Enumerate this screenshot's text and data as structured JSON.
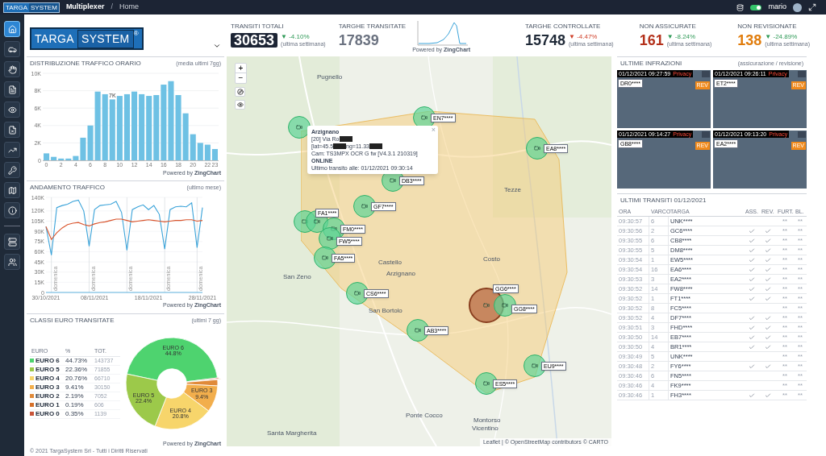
{
  "topbar": {
    "brand": [
      "TARGA",
      "SYSTEM"
    ],
    "app": "Multiplexer",
    "separator": "/",
    "page": "Home",
    "db_online": true,
    "user": "mario"
  },
  "sidebar": {
    "items": [
      {
        "selected": true
      },
      {
        "selected": false
      },
      {
        "selected": false
      },
      {
        "selected": false
      },
      {
        "selected": false
      },
      {
        "selected": false
      },
      {
        "selected": false
      },
      {
        "selected": false
      },
      {
        "selected": false
      },
      {
        "selected": false
      },
      {
        "selected": false
      },
      {
        "selected": false
      }
    ]
  },
  "header": {
    "logo": [
      "TARGA",
      "SYSTEM"
    ],
    "logo_mark": "®"
  },
  "kpis": [
    {
      "label": "TRANSITI TOTALI",
      "value": "30653",
      "kind": "boxed",
      "color": "#1c2434",
      "change": {
        "text": "▼ -4.10%",
        "color": "#2f9a57"
      },
      "period": "(ultima settimana)"
    },
    {
      "label": "TARGHE TRANSITATE",
      "value": "17839",
      "kind": "plain",
      "color": "#6b7280"
    },
    {
      "label": "TARGHE CONTROLLATE",
      "value": "15748",
      "kind": "plain",
      "color": "#1f2937",
      "change": {
        "text": "▼ -4.47%",
        "color": "#d0402a"
      },
      "period": "(ultima settimana)"
    },
    {
      "label": "NON ASSICURATE",
      "value": "161",
      "kind": "plain",
      "color": "#b4321c",
      "change": {
        "text": "▼ -8.24%",
        "color": "#2f9a57"
      },
      "period": "(ultima settimana)"
    },
    {
      "label": "NON REVISIONATE",
      "value": "138",
      "kind": "plain",
      "color": "#e07c0c",
      "change": {
        "text": "▼ -24.89%",
        "color": "#2f9a57"
      },
      "period": "(ultima settimana)"
    }
  ],
  "sparkline": {
    "credit": "Powered by **ZingChart**"
  },
  "hourly": {
    "title": "DISTRIBUZIONE TRAFFICO ORARIO",
    "note": "(media ultimi 7gg)",
    "credit": "Powered by **ZingChart**",
    "chart_data": {
      "type": "bar",
      "x": [
        0,
        1,
        2,
        3,
        4,
        5,
        6,
        7,
        8,
        9,
        10,
        11,
        12,
        13,
        14,
        15,
        16,
        17,
        18,
        19,
        20,
        21,
        22,
        23
      ],
      "series": [
        {
          "color": "#6ec1e4",
          "values": [
            800,
            400,
            200,
            200,
            500,
            2600,
            4000,
            7900,
            7600,
            7000,
            7400,
            7600,
            7900,
            7600,
            7400,
            7500,
            8700,
            9100,
            7500,
            5400,
            3000,
            2000,
            1800,
            1300
          ]
        }
      ],
      "xlim": [
        -0.5,
        23.5
      ],
      "ylim": [
        0,
        10000
      ],
      "grid": true,
      "xticks": [
        0,
        2,
        4,
        6,
        8,
        10,
        12,
        14,
        16,
        18,
        20,
        22,
        23
      ],
      "yticks": [
        {
          "value": 0,
          "label": "0"
        },
        {
          "value": 2000,
          "label": "2K"
        },
        {
          "value": 4000,
          "label": "4K"
        },
        {
          "value": 6000,
          "label": "6K"
        },
        {
          "value": 8000,
          "label": "8K"
        },
        {
          "value": 10000,
          "label": "10K"
        }
      ],
      "annotations": [
        {
          "x": 9,
          "y": 7000,
          "text": "7K"
        }
      ]
    }
  },
  "trend": {
    "title": "ANDAMENTO TRAFFICO",
    "note": "(ultimo mese)",
    "credit": "Powered by **ZingChart**",
    "chart_data": {
      "type": "line",
      "categories": [
        "30/10/2021",
        null,
        null,
        null,
        null,
        null,
        null,
        null,
        null,
        "08/11/2021",
        null,
        null,
        null,
        null,
        null,
        null,
        null,
        null,
        null,
        "18/11/2021",
        null,
        null,
        null,
        null,
        null,
        null,
        null,
        null,
        null,
        "28/11/2021"
      ],
      "series": [
        {
          "color": "#3aa3d9",
          "values": [
            97,
            55,
            125,
            128,
            130,
            134,
            136,
            120,
            68,
            122,
            128,
            129,
            130,
            134,
            118,
            62,
            122,
            126,
            129,
            122,
            128,
            115,
            64,
            122,
            126,
            127,
            126,
            132,
            66,
            125
          ]
        },
        {
          "color": "#d9532b",
          "values": [
            97,
            78,
            88,
            95,
            100,
            102,
            103,
            100,
            98,
            101,
            103,
            104,
            106,
            108,
            108,
            106,
            104,
            105,
            106,
            107,
            106,
            105,
            104,
            105,
            106,
            106,
            107,
            107,
            105,
            106
          ]
        }
      ],
      "ylim": [
        0,
        140
      ],
      "grid": true,
      "yticks": [
        {
          "value": 0,
          "label": "0"
        },
        {
          "value": 15,
          "label": "15K"
        },
        {
          "value": 30,
          "label": "30K"
        },
        {
          "value": 45,
          "label": "45K"
        },
        {
          "value": 60,
          "label": "60K"
        },
        {
          "value": 75,
          "label": "75K"
        },
        {
          "value": 90,
          "label": "90K"
        },
        {
          "value": 105,
          "label": "105K"
        },
        {
          "value": 120,
          "label": "120K"
        },
        {
          "value": 140,
          "label": "140K"
        }
      ],
      "annotations": [
        "domenica",
        "domenica",
        "domenica",
        "domenica",
        "domenica"
      ]
    }
  },
  "euro": {
    "title": "CLASSI EURO TRANSITATE",
    "note": "(ultimi 7 gg)",
    "credit": "Powered by **ZingChart**",
    "columns": [
      "EURO",
      "%",
      "TOT."
    ],
    "rows": [
      {
        "name": "EURO 6",
        "percent": "44.73%",
        "total": "143737",
        "color": "#4ed36f"
      },
      {
        "name": "EURO 5",
        "percent": "22.36%",
        "total": "71855",
        "color": "#9cc94a"
      },
      {
        "name": "EURO 4",
        "percent": "20.76%",
        "total": "66710",
        "color": "#f7d56b"
      },
      {
        "name": "EURO 3",
        "percent": "9.41%",
        "total": "30150",
        "color": "#f2ae4c"
      },
      {
        "name": "EURO 2",
        "percent": "2.19%",
        "total": "7052",
        "color": "#e08a3a"
      },
      {
        "name": "EURO 1",
        "percent": "0.19%",
        "total": "606",
        "color": "#d5702a"
      },
      {
        "name": "EURO 0",
        "percent": "0.35%",
        "total": "1139",
        "color": "#c8553a"
      }
    ],
    "chart_data": {
      "type": "donut",
      "categories": [
        "EURO 6",
        "EURO 5",
        "EURO 4",
        "EURO 3",
        null,
        null,
        null
      ],
      "values": [
        44.8,
        22.4,
        20.8,
        9.4,
        2.2,
        0.2,
        0.4
      ],
      "value_labels": [
        "44.8%",
        "22.4%",
        "20.8%",
        "9.4%",
        null,
        null,
        null
      ]
    }
  },
  "map": {
    "places": [
      "Pugnello",
      "Tezze",
      "Castello",
      "Arzignano",
      "San Zeno",
      "Costo",
      "San Bortolo",
      "Ponte Cocco",
      "Santa Margherita",
      "Montorso",
      "Vicentino"
    ],
    "markers": [
      {
        "plate": "EN7****",
        "alert": false
      },
      {
        "plate": "EA8****",
        "alert": false
      },
      {
        "plate": "DB3****",
        "alert": false
      },
      {
        "plate": "GF7****",
        "alert": false
      },
      {
        "plate": "FA1****",
        "alert": false
      },
      {
        "plate": "FM0****",
        "alert": false
      },
      {
        "plate": "FW5****",
        "alert": false
      },
      {
        "plate": "FA5****",
        "alert": false
      },
      {
        "plate": "CS6****",
        "alert": false
      },
      {
        "plate": "GG6****",
        "alert": true
      },
      {
        "plate": "GG8****",
        "alert": false
      },
      {
        "plate": "AB3****",
        "alert": false
      },
      {
        "plate": "EU9****",
        "alert": false
      },
      {
        "plate": "ES5****",
        "alert": false
      }
    ],
    "popup": {
      "close": "×",
      "lines": [
        {
          "parts": [
            "Arzignano"
          ],
          "bold": true,
          "redacted": false
        },
        {
          "parts": [
            "[20] Via Ro"
          ],
          "bold": false,
          "redacted": true
        },
        {
          "parts": [
            "[lat=45.5",
            "ng=11.33"
          ],
          "bold": false,
          "redacted": true
        },
        {
          "parts": [
            "Cam: TS3MPX OCR G fw [V4.3.1 210319]"
          ],
          "bold": false,
          "redacted": false
        },
        {
          "parts": [
            "ONLINE"
          ],
          "bold": true,
          "redacted": false
        },
        {
          "parts": [
            "Ultimo transito alle: 01/12/2021 09:30:14"
          ],
          "bold": false,
          "redacted": false
        }
      ]
    },
    "zoom_in": "+",
    "zoom_out": "−",
    "attribution": "Leaflet | © OpenStreetMap contributors © CARTO"
  },
  "infractions": {
    "title": "ULTIME INFRAZIONI",
    "note": "(assicurazione / revisione)",
    "items": [
      {
        "time": "01/12/2021 09:27:59",
        "tag": "Privacy",
        "plate": "DR0****",
        "badge": "REV"
      },
      {
        "time": "01/12/2021 09:26:11",
        "tag": "Privacy",
        "plate": "ET2****",
        "badge": "REV"
      },
      {
        "time": "01/12/2021 09:14:27",
        "tag": "Privacy",
        "plate": "GB8****",
        "badge": "REV"
      },
      {
        "time": "01/12/2021 09:13:20",
        "tag": "Privacy",
        "plate": "EA2****",
        "badge": "REV"
      }
    ]
  },
  "transits": {
    "title": "ULTIMI TRANSITI 01/12/2021",
    "columns": [
      "ORA",
      "VARCO",
      "TARGA",
      "ASS.",
      "REV.",
      "FURT.",
      "BL."
    ],
    "rows": [
      {
        "time": "09:30:57",
        "gate": "6",
        "plate": "UNK****",
        "ass": false,
        "rev": false,
        "furt": "**",
        "bl": "**"
      },
      {
        "time": "09:30:56",
        "gate": "2",
        "plate": "GC6****",
        "ass": true,
        "rev": true,
        "furt": "**",
        "bl": "**"
      },
      {
        "time": "09:30:55",
        "gate": "6",
        "plate": "CB8****",
        "ass": true,
        "rev": true,
        "furt": "**",
        "bl": "**"
      },
      {
        "time": "09:30:55",
        "gate": "5",
        "plate": "DM8****",
        "ass": true,
        "rev": true,
        "furt": "**",
        "bl": "**"
      },
      {
        "time": "09:30:54",
        "gate": "1",
        "plate": "EW5****",
        "ass": true,
        "rev": true,
        "furt": "**",
        "bl": "**"
      },
      {
        "time": "09:30:54",
        "gate": "16",
        "plate": "EA6****",
        "ass": true,
        "rev": true,
        "furt": "**",
        "bl": "**"
      },
      {
        "time": "09:30:53",
        "gate": "3",
        "plate": "EA2****",
        "ass": true,
        "rev": true,
        "furt": "**",
        "bl": "**"
      },
      {
        "time": "09:30:52",
        "gate": "14",
        "plate": "FW8****",
        "ass": true,
        "rev": true,
        "furt": "**",
        "bl": "**"
      },
      {
        "time": "09:30:52",
        "gate": "1",
        "plate": "FT1****",
        "ass": true,
        "rev": true,
        "furt": "**",
        "bl": "**"
      },
      {
        "time": "09:30:52",
        "gate": "8",
        "plate": "FC5****",
        "ass": false,
        "rev": false,
        "furt": "**",
        "bl": "**"
      },
      {
        "time": "09:30:52",
        "gate": "4",
        "plate": "DF7****",
        "ass": true,
        "rev": true,
        "furt": "**",
        "bl": "**"
      },
      {
        "time": "09:30:51",
        "gate": "3",
        "plate": "FHD****",
        "ass": true,
        "rev": true,
        "furt": "**",
        "bl": "**"
      },
      {
        "time": "09:30:50",
        "gate": "14",
        "plate": "EB7****",
        "ass": true,
        "rev": true,
        "furt": "**",
        "bl": "**"
      },
      {
        "time": "09:30:50",
        "gate": "4",
        "plate": "BR1****",
        "ass": true,
        "rev": true,
        "furt": "**",
        "bl": "**"
      },
      {
        "time": "09:30:49",
        "gate": "5",
        "plate": "UNK****",
        "ass": false,
        "rev": false,
        "furt": "**",
        "bl": "**"
      },
      {
        "time": "09:30:48",
        "gate": "2",
        "plate": "FY6****",
        "ass": true,
        "rev": true,
        "furt": "**",
        "bl": "**"
      },
      {
        "time": "09:30:46",
        "gate": "6",
        "plate": "FN5****",
        "ass": false,
        "rev": false,
        "furt": "**",
        "bl": "**"
      },
      {
        "time": "09:30:46",
        "gate": "4",
        "plate": "FK9****",
        "ass": false,
        "rev": false,
        "furt": "**",
        "bl": "**"
      },
      {
        "time": "09:30:46",
        "gate": "1",
        "plate": "FH3****",
        "ass": true,
        "rev": true,
        "furt": "**",
        "bl": "**"
      }
    ]
  },
  "footer": {
    "copyright": "© 2021 TargaSystem Srl - Tutti i Diritti Riservati"
  }
}
